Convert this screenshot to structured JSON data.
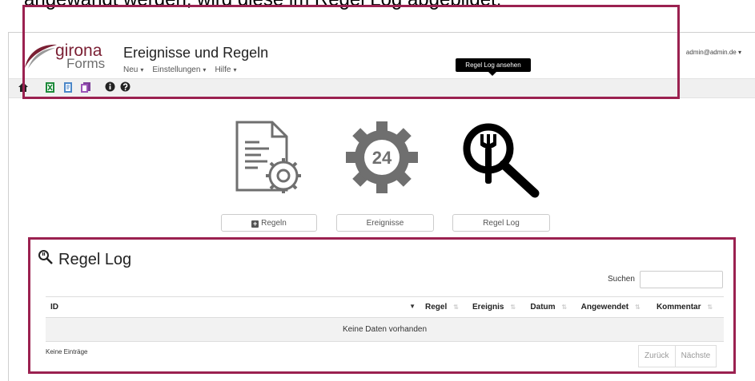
{
  "doc_text": "angewandt werden, wird diese im Regel Log abgebildet.",
  "app": {
    "logo_brand": "girona",
    "logo_sub": "Forms",
    "page_title": "Ereignisse und Regeln",
    "menu": [
      {
        "label": "Neu"
      },
      {
        "label": "Einstellungen"
      },
      {
        "label": "Hilfe"
      }
    ],
    "user": "admin@admin.de"
  },
  "toolbar": {
    "icons": [
      "home-icon",
      "excel-icon",
      "document-icon",
      "documents-icon",
      "info-icon",
      "help-icon"
    ]
  },
  "tooltip": "Regel Log ansehen",
  "tiles": {
    "rules_icon": "document-gear-icon",
    "events_icon": "gear-24-icon",
    "events_gear_text": "24",
    "log_icon": "wrench-magnifier-icon"
  },
  "buttons": {
    "rules": "Regeln",
    "events": "Ereignisse",
    "log": "Regel Log"
  },
  "panel": {
    "title": "Regel Log",
    "search_label": "Suchen",
    "search_value": "",
    "columns": [
      "ID",
      "Regel",
      "Ereignis",
      "Datum",
      "Angewendet",
      "Kommentar"
    ],
    "empty_message": "Keine Daten vorhanden",
    "info": "Keine Einträge",
    "prev": "Zurück",
    "next": "Nächste"
  },
  "colors": {
    "highlight": "#9b2150",
    "brand": "#7a1f33",
    "icon_gray": "#6f6f6f"
  }
}
